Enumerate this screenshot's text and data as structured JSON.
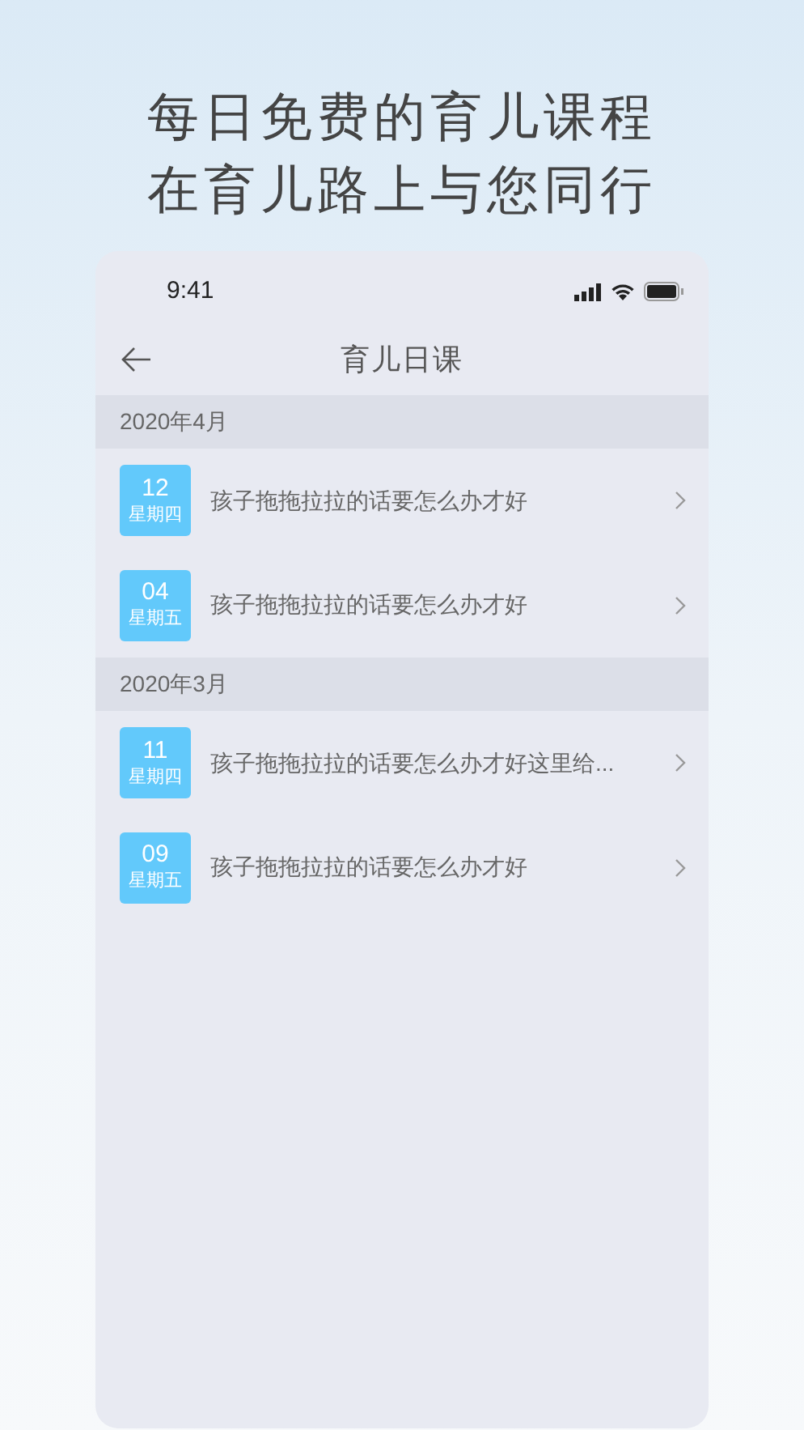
{
  "headline": [
    "每日免费的育儿课程",
    "在育儿路上与您同行"
  ],
  "status_bar": {
    "time": "9:41"
  },
  "nav": {
    "title": "育儿日课"
  },
  "sections": [
    {
      "title": "2020年4月",
      "items": [
        {
          "day": "12",
          "weekday": "星期四",
          "text": "孩子拖拖拉拉的话要怎么办才好"
        },
        {
          "day": "04",
          "weekday": "星期五",
          "text": "孩子拖拖拉拉的话要怎么办才好"
        }
      ]
    },
    {
      "title": "2020年3月",
      "items": [
        {
          "day": "11",
          "weekday": "星期四",
          "text": "孩子拖拖拉拉的话要怎么办才好这里给..."
        },
        {
          "day": "09",
          "weekday": "星期五",
          "text": "孩子拖拖拉拉的话要怎么办才好"
        }
      ]
    }
  ]
}
